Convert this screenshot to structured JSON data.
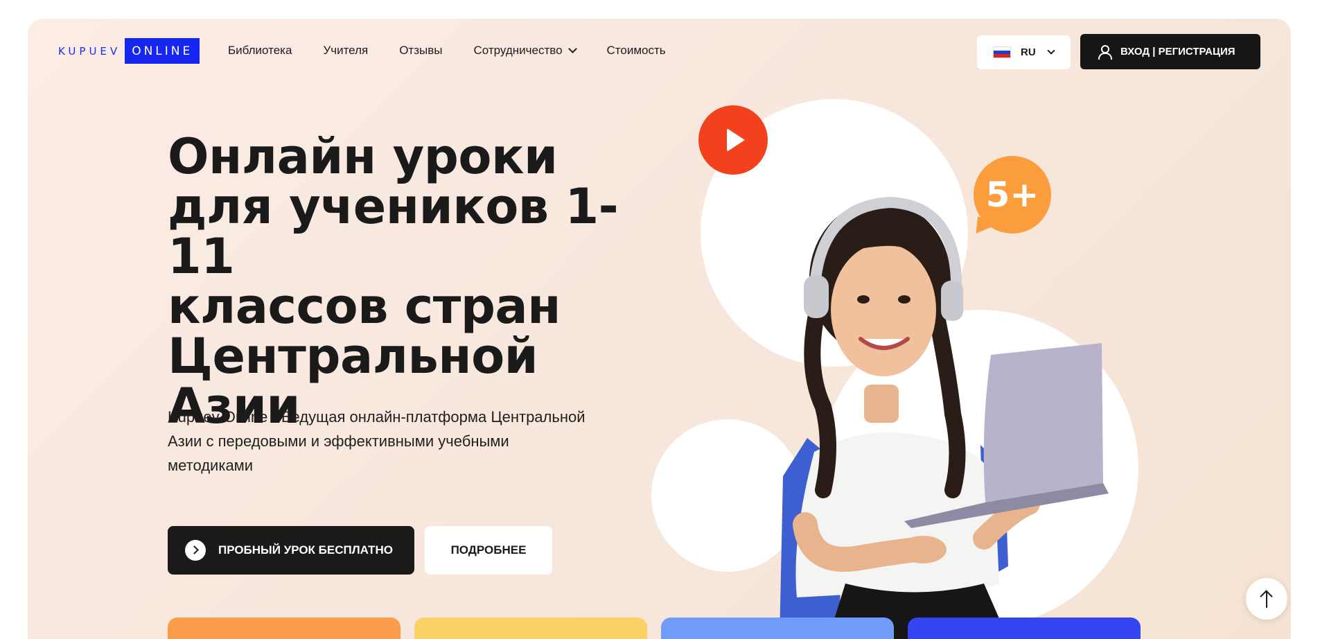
{
  "logo": {
    "left": "KUPUEV",
    "right": "ONLINE"
  },
  "nav": {
    "items": [
      {
        "label": "Библиотека"
      },
      {
        "label": "Учителя"
      },
      {
        "label": "Отзывы"
      },
      {
        "label": "Сотрудничество",
        "has_dropdown": true
      },
      {
        "label": "Стоимость"
      }
    ]
  },
  "language": {
    "label": "RU",
    "flag_icon": "russia-flag-icon",
    "flag_colors": [
      "#ffffff",
      "#1c3fd1",
      "#e0231a"
    ]
  },
  "auth": {
    "label": "ВХОД | РЕГИСТРАЦИЯ",
    "icon": "user-icon"
  },
  "hero": {
    "title_lines": [
      "Онлайн уроки",
      "для учеников 1-11",
      "классов стран",
      "Центральной",
      "Азии"
    ],
    "subtitle_lines": [
      "Kupuev Online - Ведущая онлайн-платформа Центральной",
      "Азии с передовыми и эффективными учебными",
      "методиками"
    ],
    "primary_button": "ПРОБНЫЙ УРОК БЕСПЛАТНО",
    "secondary_button": "ПОДРОБНЕЕ",
    "badge": "5+",
    "play_icon": "play-icon"
  },
  "colors": {
    "accent_red": "#f3411e",
    "badge_orange": "#fb9c3d",
    "dark": "#1a1a1a",
    "brand_blue": "#1526f0",
    "card_colors": [
      "#fb9c4a",
      "#fbd165",
      "#6f9bfb",
      "#3446f2"
    ]
  },
  "scroll_top_icon": "arrow-up-icon"
}
